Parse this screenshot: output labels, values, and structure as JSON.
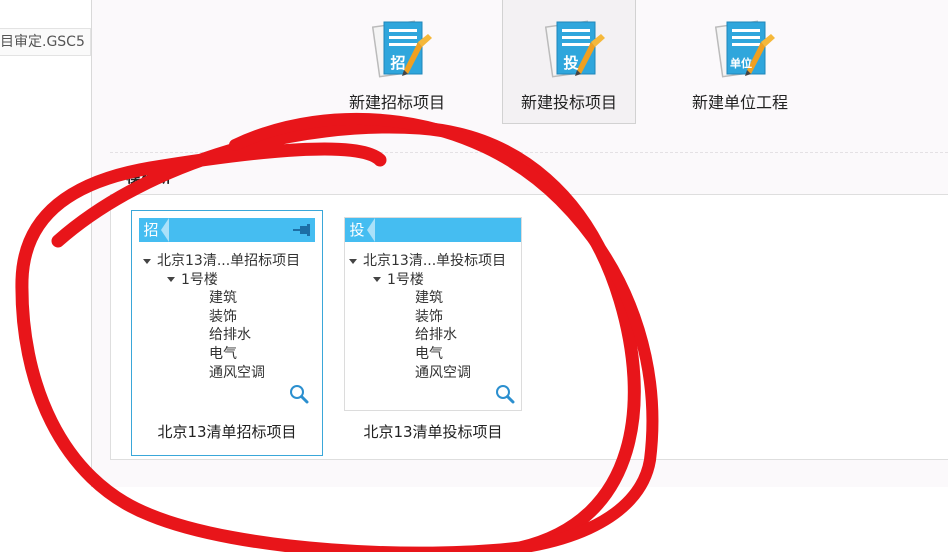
{
  "sidebar": {
    "recent_file": "目审定.GSC5"
  },
  "toolbar": {
    "buttons": [
      {
        "label": "新建招标项目",
        "badge": "招",
        "icon": "bid-invite-doc-icon"
      },
      {
        "label": "新建投标项目",
        "badge": "投",
        "icon": "bid-submit-doc-icon",
        "selected": true
      },
      {
        "label": "新建单位工程",
        "badge": "单位",
        "icon": "unit-project-doc-icon"
      }
    ]
  },
  "templates": {
    "section_title": "模板新",
    "cards": [
      {
        "tag": "招",
        "label": "北京13清单招标项目",
        "tree": [
          "北京13清...单招标项目",
          "1号楼",
          "建筑",
          "装饰",
          "给排水",
          "电气",
          "通风空调"
        ],
        "active": true
      },
      {
        "tag": "投",
        "label": "北京13清单投标项目",
        "tree": [
          "北京13清...单投标项目",
          "1号楼",
          "建筑",
          "装饰",
          "给排水",
          "电气",
          "通风空调"
        ],
        "active": false
      }
    ]
  },
  "colors": {
    "accent": "#45bdf1",
    "selected_border": "#3aa7d9",
    "annotation": "#e8151a"
  }
}
